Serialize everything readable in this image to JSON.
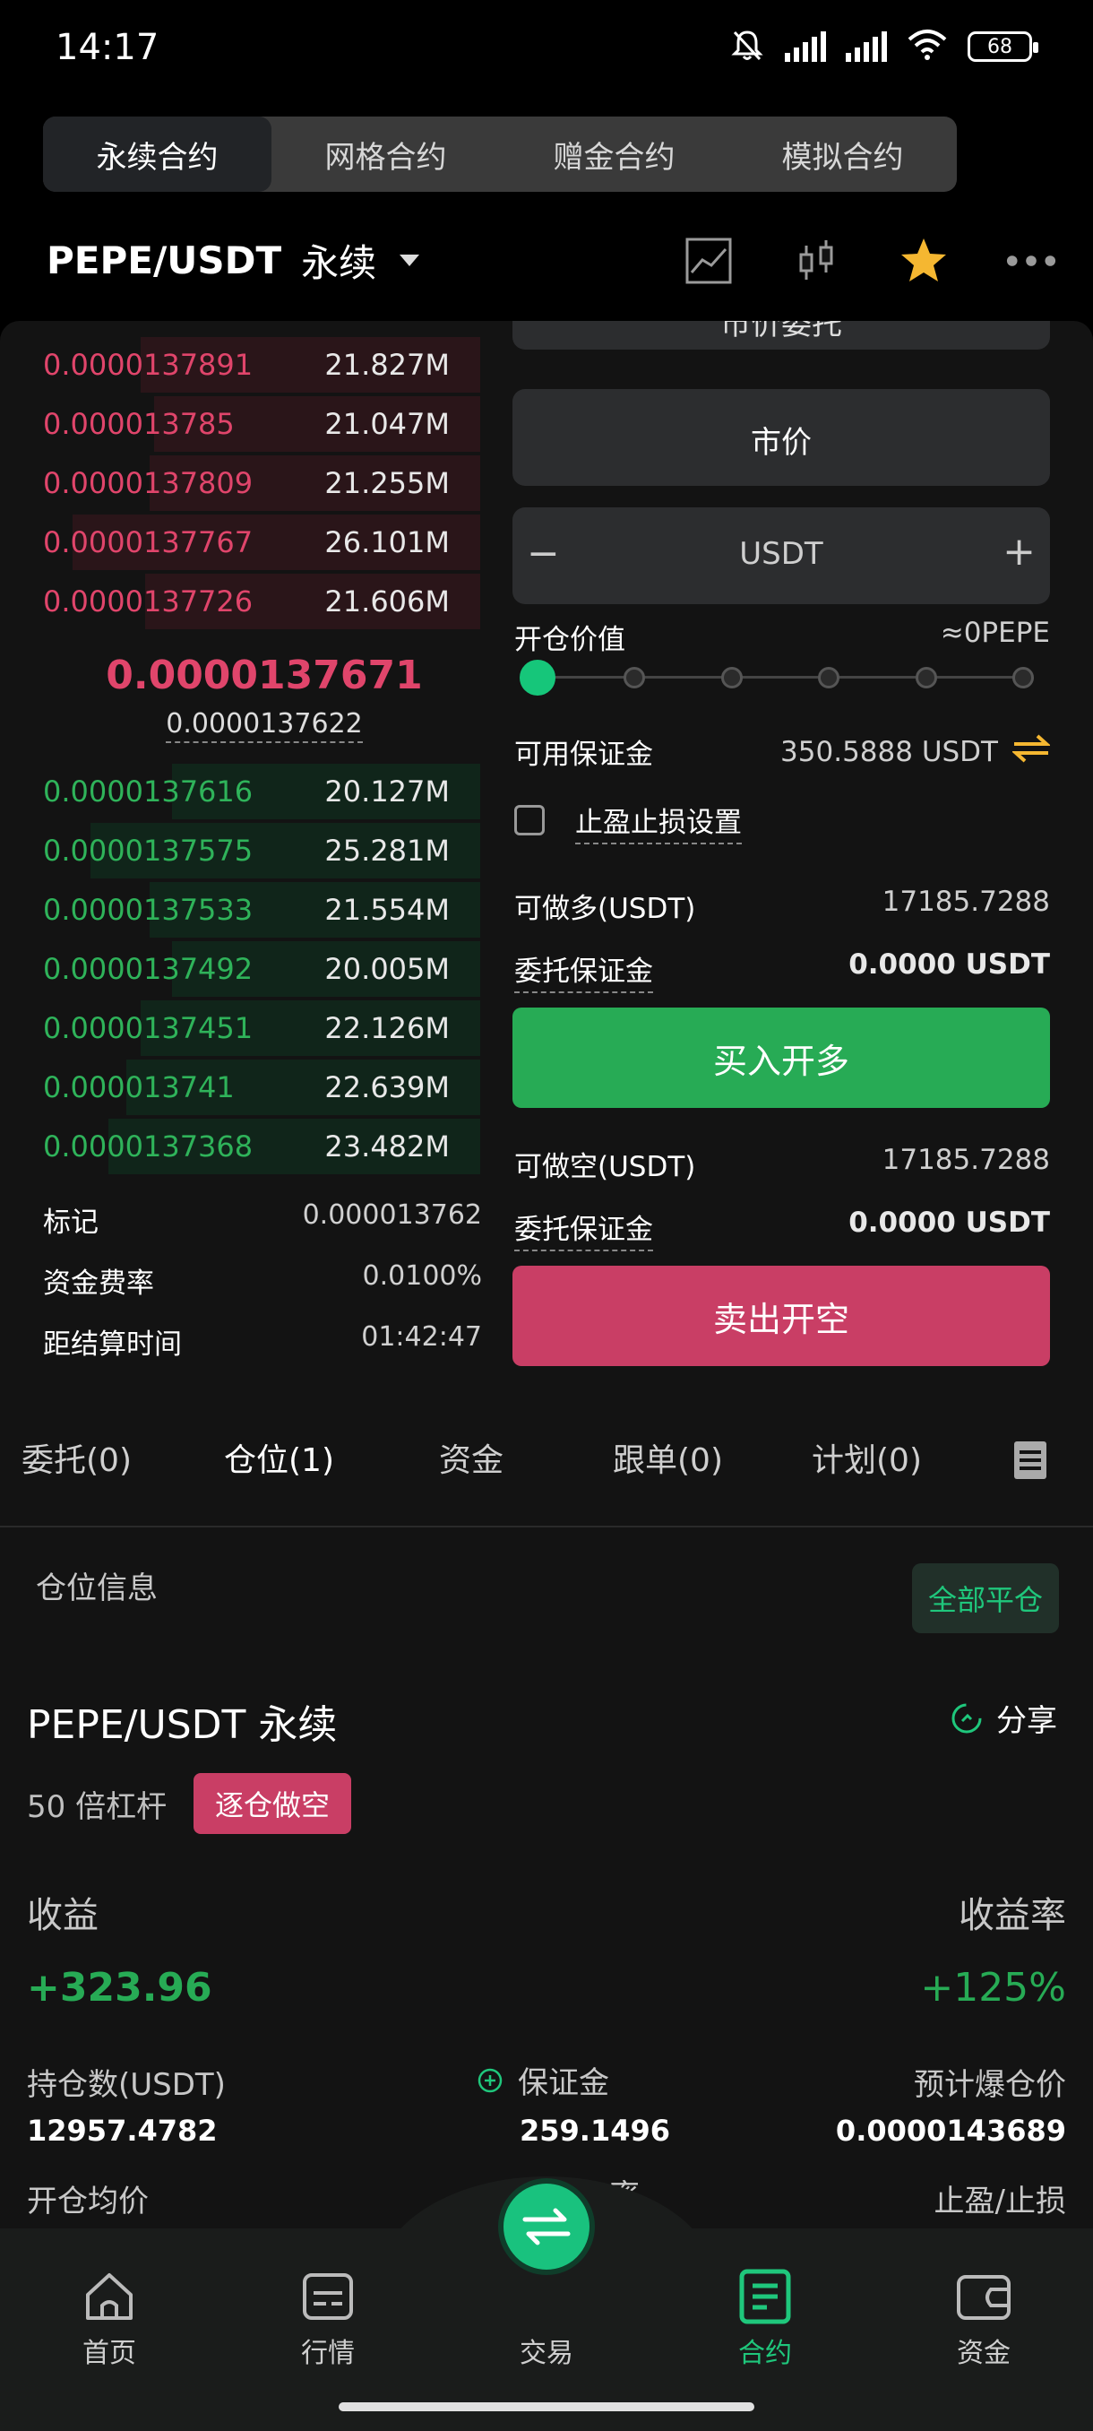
{
  "status": {
    "time": "14:17",
    "battery": "68"
  },
  "tabs": [
    "永续合约",
    "网格合约",
    "赠金合约",
    "模拟合约"
  ],
  "pair": {
    "symbol": "PEPE/USDT",
    "type": "永续"
  },
  "orderbook": {
    "asks": [
      {
        "price": "0.0000137891",
        "qty": "21.827M",
        "depth": 0.75
      },
      {
        "price": "0.000013785",
        "qty": "21.047M",
        "depth": 0.72
      },
      {
        "price": "0.0000137809",
        "qty": "21.255M",
        "depth": 0.73
      },
      {
        "price": "0.0000137767",
        "qty": "26.101M",
        "depth": 0.9
      },
      {
        "price": "0.0000137726",
        "qty": "21.606M",
        "depth": 0.74
      }
    ],
    "last_price": "0.0000137671",
    "mark_line": "0.0000137622",
    "bids": [
      {
        "price": "0.0000137616",
        "qty": "20.127M",
        "depth": 0.68
      },
      {
        "price": "0.0000137575",
        "qty": "25.281M",
        "depth": 0.86
      },
      {
        "price": "0.0000137533",
        "qty": "21.554M",
        "depth": 0.73
      },
      {
        "price": "0.0000137492",
        "qty": "20.005M",
        "depth": 0.68
      },
      {
        "price": "0.0000137451",
        "qty": "22.126M",
        "depth": 0.75
      },
      {
        "price": "0.000013741",
        "qty": "22.639M",
        "depth": 0.78
      },
      {
        "price": "0.0000137368",
        "qty": "23.482M",
        "depth": 0.82
      }
    ],
    "info": [
      {
        "k": "标记",
        "v": "0.000013762"
      },
      {
        "k": "资金费率",
        "v": "0.0100%"
      },
      {
        "k": "距结算时间",
        "v": "01:42:47"
      }
    ]
  },
  "form": {
    "order_type": "市价委托",
    "price": "市价",
    "amount_unit": "USDT",
    "open_value_label": "开仓价值",
    "open_value": "≈0PEPE",
    "available_label": "可用保证金",
    "available": "350.5888 USDT",
    "tpsl_label": "止盈止损设置",
    "long_label": "可做多(USDT)",
    "long_value": "17185.7288",
    "margin_label": "委托保证金",
    "margin_value": "0.0000 USDT",
    "buy_btn": "买入开多",
    "short_label": "可做空(USDT)",
    "short_value": "17185.7288",
    "margin_value2": "0.0000 USDT",
    "sell_btn": "卖出开空",
    "slider_level": 0
  },
  "bottom_tabs": [
    "委托(0)",
    "仓位(1)",
    "资金",
    "跟单(0)",
    "计划(0)"
  ],
  "position": {
    "section": "仓位信息",
    "close_all": "全部平仓",
    "title": "PEPE/USDT 永续",
    "share": "分享",
    "leverage": "50 倍杠杆",
    "mode": "逐仓做空",
    "pnl_label": "收益",
    "pnl_rate_label": "收益率",
    "pnl": "+323.96",
    "pnl_rate": "+125%",
    "size_label": "持仓数(USDT)",
    "margin_label": "保证金",
    "liq_label": "预计爆仓价",
    "size": "12957.4782",
    "margin": "259.1496",
    "liq": "0.0000143689",
    "entry_label": "开仓均价",
    "mid_partial": "率",
    "tpsl_label": "止盈/止损"
  },
  "nav": [
    "首页",
    "行情",
    "交易",
    "合约",
    "资金"
  ],
  "colors": {
    "green": "#27ab55",
    "red": "#c93e65",
    "accent": "#1fc77c"
  }
}
